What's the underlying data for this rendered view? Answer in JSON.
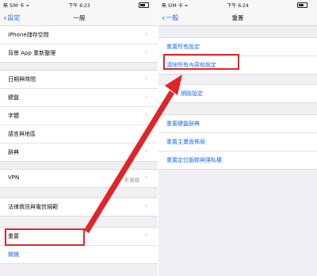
{
  "left": {
    "status": {
      "carrier": "無 SIM 卡 ≈",
      "time": "下午 6:23"
    },
    "nav": {
      "back": "設定",
      "title": "一般"
    },
    "groups": [
      [
        "iPhone儲存空間",
        "背景 App 重新整理"
      ],
      [
        "日期與時間",
        "鍵盤",
        "字體",
        "語言與地區",
        "辭典"
      ],
      [
        "VPN"
      ],
      [
        "法律資訊與電信規範"
      ],
      [
        "重置",
        "關機"
      ]
    ],
    "vpn_value": "未連線"
  },
  "right": {
    "status": {
      "carrier": "無 SIM 卡 ≈",
      "time": "下午 6:24"
    },
    "nav": {
      "back": "一般",
      "title": "重置"
    },
    "groups": [
      [
        "重置所有設定",
        "清除所有內容和設定"
      ],
      [
        "網路設定"
      ],
      [
        "重置鍵盤辭典",
        "重置主畫面佈局",
        "重置定位服務與隱私權"
      ]
    ]
  },
  "colors": {
    "accent": "#1e6ef5",
    "highlight": "#e0242a",
    "background": "#efeff4"
  }
}
